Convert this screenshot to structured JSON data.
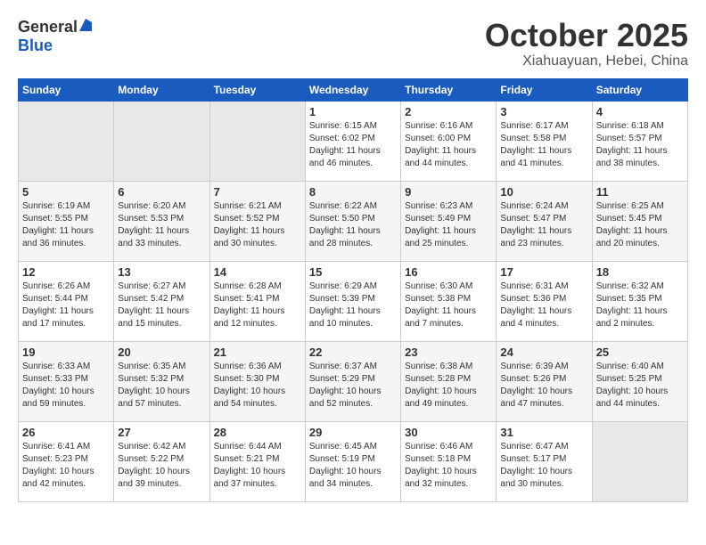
{
  "header": {
    "logo_line1": "General",
    "logo_line2": "Blue",
    "month": "October 2025",
    "location": "Xiahuayuan, Hebei, China"
  },
  "days_of_week": [
    "Sunday",
    "Monday",
    "Tuesday",
    "Wednesday",
    "Thursday",
    "Friday",
    "Saturday"
  ],
  "weeks": [
    [
      {
        "day": "",
        "empty": true
      },
      {
        "day": "",
        "empty": true
      },
      {
        "day": "",
        "empty": true
      },
      {
        "day": "1",
        "sunrise": "6:15 AM",
        "sunset": "6:02 PM",
        "daylight": "11 hours and 46 minutes."
      },
      {
        "day": "2",
        "sunrise": "6:16 AM",
        "sunset": "6:00 PM",
        "daylight": "11 hours and 44 minutes."
      },
      {
        "day": "3",
        "sunrise": "6:17 AM",
        "sunset": "5:58 PM",
        "daylight": "11 hours and 41 minutes."
      },
      {
        "day": "4",
        "sunrise": "6:18 AM",
        "sunset": "5:57 PM",
        "daylight": "11 hours and 38 minutes."
      }
    ],
    [
      {
        "day": "5",
        "sunrise": "6:19 AM",
        "sunset": "5:55 PM",
        "daylight": "11 hours and 36 minutes."
      },
      {
        "day": "6",
        "sunrise": "6:20 AM",
        "sunset": "5:53 PM",
        "daylight": "11 hours and 33 minutes."
      },
      {
        "day": "7",
        "sunrise": "6:21 AM",
        "sunset": "5:52 PM",
        "daylight": "11 hours and 30 minutes."
      },
      {
        "day": "8",
        "sunrise": "6:22 AM",
        "sunset": "5:50 PM",
        "daylight": "11 hours and 28 minutes."
      },
      {
        "day": "9",
        "sunrise": "6:23 AM",
        "sunset": "5:49 PM",
        "daylight": "11 hours and 25 minutes."
      },
      {
        "day": "10",
        "sunrise": "6:24 AM",
        "sunset": "5:47 PM",
        "daylight": "11 hours and 23 minutes."
      },
      {
        "day": "11",
        "sunrise": "6:25 AM",
        "sunset": "5:45 PM",
        "daylight": "11 hours and 20 minutes."
      }
    ],
    [
      {
        "day": "12",
        "sunrise": "6:26 AM",
        "sunset": "5:44 PM",
        "daylight": "11 hours and 17 minutes."
      },
      {
        "day": "13",
        "sunrise": "6:27 AM",
        "sunset": "5:42 PM",
        "daylight": "11 hours and 15 minutes."
      },
      {
        "day": "14",
        "sunrise": "6:28 AM",
        "sunset": "5:41 PM",
        "daylight": "11 hours and 12 minutes."
      },
      {
        "day": "15",
        "sunrise": "6:29 AM",
        "sunset": "5:39 PM",
        "daylight": "11 hours and 10 minutes."
      },
      {
        "day": "16",
        "sunrise": "6:30 AM",
        "sunset": "5:38 PM",
        "daylight": "11 hours and 7 minutes."
      },
      {
        "day": "17",
        "sunrise": "6:31 AM",
        "sunset": "5:36 PM",
        "daylight": "11 hours and 4 minutes."
      },
      {
        "day": "18",
        "sunrise": "6:32 AM",
        "sunset": "5:35 PM",
        "daylight": "11 hours and 2 minutes."
      }
    ],
    [
      {
        "day": "19",
        "sunrise": "6:33 AM",
        "sunset": "5:33 PM",
        "daylight": "10 hours and 59 minutes."
      },
      {
        "day": "20",
        "sunrise": "6:35 AM",
        "sunset": "5:32 PM",
        "daylight": "10 hours and 57 minutes."
      },
      {
        "day": "21",
        "sunrise": "6:36 AM",
        "sunset": "5:30 PM",
        "daylight": "10 hours and 54 minutes."
      },
      {
        "day": "22",
        "sunrise": "6:37 AM",
        "sunset": "5:29 PM",
        "daylight": "10 hours and 52 minutes."
      },
      {
        "day": "23",
        "sunrise": "6:38 AM",
        "sunset": "5:28 PM",
        "daylight": "10 hours and 49 minutes."
      },
      {
        "day": "24",
        "sunrise": "6:39 AM",
        "sunset": "5:26 PM",
        "daylight": "10 hours and 47 minutes."
      },
      {
        "day": "25",
        "sunrise": "6:40 AM",
        "sunset": "5:25 PM",
        "daylight": "10 hours and 44 minutes."
      }
    ],
    [
      {
        "day": "26",
        "sunrise": "6:41 AM",
        "sunset": "5:23 PM",
        "daylight": "10 hours and 42 minutes."
      },
      {
        "day": "27",
        "sunrise": "6:42 AM",
        "sunset": "5:22 PM",
        "daylight": "10 hours and 39 minutes."
      },
      {
        "day": "28",
        "sunrise": "6:44 AM",
        "sunset": "5:21 PM",
        "daylight": "10 hours and 37 minutes."
      },
      {
        "day": "29",
        "sunrise": "6:45 AM",
        "sunset": "5:19 PM",
        "daylight": "10 hours and 34 minutes."
      },
      {
        "day": "30",
        "sunrise": "6:46 AM",
        "sunset": "5:18 PM",
        "daylight": "10 hours and 32 minutes."
      },
      {
        "day": "31",
        "sunrise": "6:47 AM",
        "sunset": "5:17 PM",
        "daylight": "10 hours and 30 minutes."
      },
      {
        "day": "",
        "empty": true
      }
    ]
  ]
}
